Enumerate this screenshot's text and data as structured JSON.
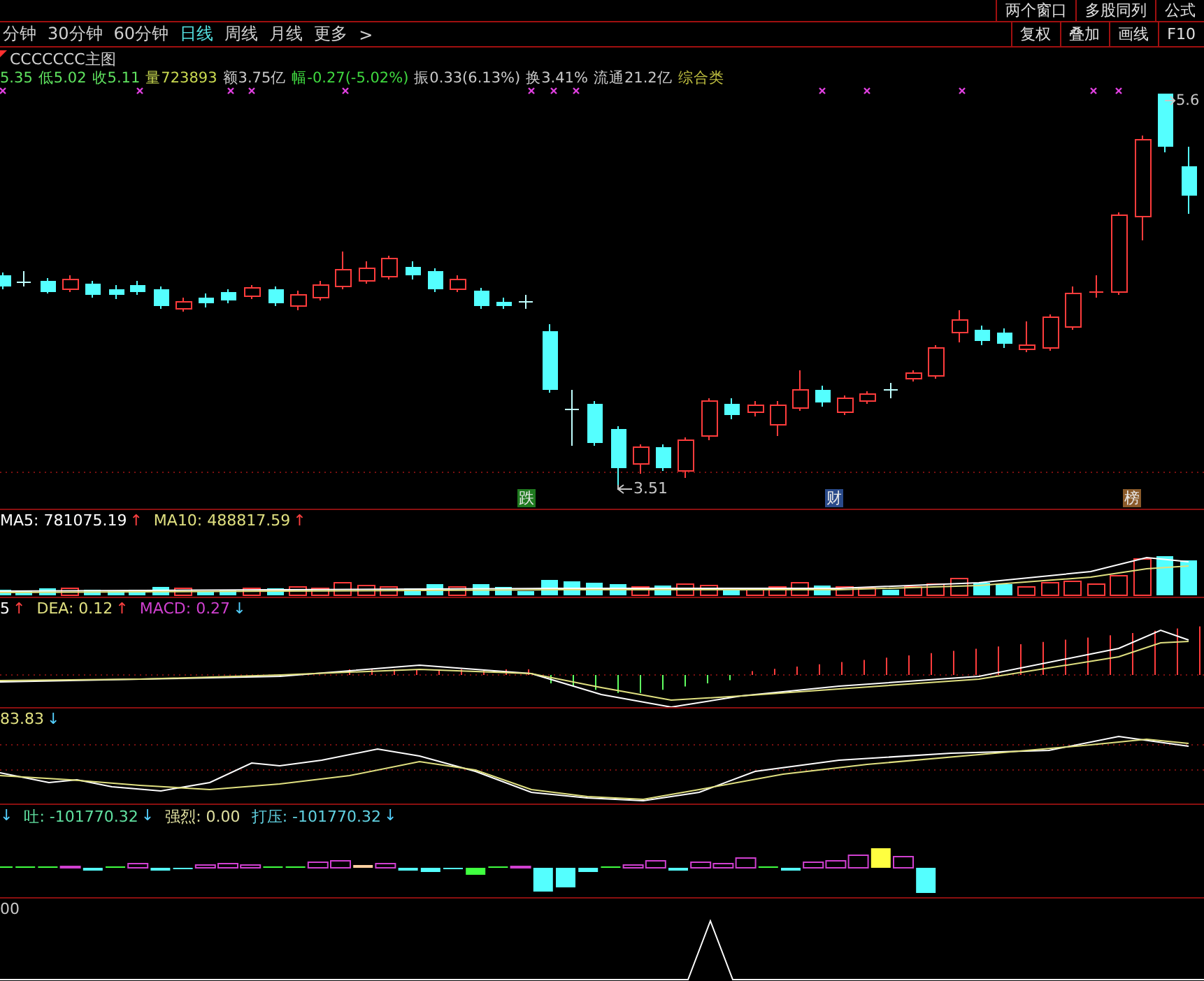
{
  "window_buttons": [
    "两个窗口",
    "多股同列",
    "公式"
  ],
  "period_tabs": [
    {
      "label": "分钟",
      "selected": false
    },
    {
      "label": "30分钟",
      "selected": false
    },
    {
      "label": "60分钟",
      "selected": false
    },
    {
      "label": "日线",
      "selected": true
    },
    {
      "label": "周线",
      "selected": false
    },
    {
      "label": "月线",
      "selected": false
    },
    {
      "label": "更多",
      "selected": false
    }
  ],
  "more_arrow": ">",
  "tool_buttons": [
    "复权",
    "叠加",
    "画线",
    "F10"
  ],
  "main_chart": {
    "title": "CCCCCCC主图",
    "quote": [
      {
        "text": "5.35",
        "color": "#5fe35f"
      },
      {
        "text": "低5.02",
        "color": "#5fe35f"
      },
      {
        "text": "收5.11",
        "color": "#5fe35f"
      },
      {
        "text": "量723893",
        "color": "#c8d850"
      },
      {
        "text": "额3.75亿",
        "color": "#c8c8c8"
      },
      {
        "text": "幅-0.27(-5.02%)",
        "color": "#3fd83f"
      },
      {
        "text": "振0.33(6.13%)",
        "color": "#c8c8c8"
      },
      {
        "text": "换3.41%",
        "color": "#c8c8c8"
      },
      {
        "text": "流通21.2亿",
        "color": "#c8c8c8"
      },
      {
        "text": "综合类",
        "color": "#c0c040"
      }
    ],
    "high_label": "5.6",
    "low_label": "3.51",
    "markers": [
      {
        "text": "跌",
        "color": "#1f7a1f"
      },
      {
        "text": "财",
        "color": "#2a4a8a"
      },
      {
        "text": "榜",
        "color": "#8a5a2a"
      }
    ]
  },
  "indicator_panels": [
    {
      "kind": "volume",
      "values": [
        {
          "text": "MA5: 781075.19",
          "color": "#ffffff",
          "arrow": "↑",
          "rising": true
        },
        {
          "text": "MA10: 488817.59",
          "color": "#e0e080",
          "arrow": "↑",
          "rising": true
        }
      ]
    },
    {
      "kind": "macd",
      "values": [
        {
          "text": "5",
          "color": "#ffffff",
          "arrow": "↑",
          "rising": true
        },
        {
          "text": "DEA: 0.12",
          "color": "#e0e080",
          "arrow": "↑",
          "rising": true
        },
        {
          "text": "MACD: 0.27",
          "color": "#d040d0",
          "arrow": "↓",
          "rising": false
        }
      ]
    },
    {
      "kind": "lines",
      "values": [
        {
          "text": "83.83",
          "color": "#e0e080",
          "arrow": "↓",
          "rising": false
        }
      ]
    },
    {
      "kind": "bars",
      "values": [
        {
          "arrow": "↓",
          "rising": false
        },
        {
          "text": "吐: -101770.32",
          "color": "#60e0a0",
          "arrow": "↓",
          "rising": false
        },
        {
          "text": "强烈: 0.00",
          "color": "#e0e0a0"
        },
        {
          "text": "打压: -101770.32",
          "color": "#60d0e0",
          "arrow": "↓",
          "rising": false
        }
      ]
    },
    {
      "kind": "peak",
      "values": [
        {
          "text": "00",
          "color": "#c8c8c8"
        }
      ]
    }
  ]
}
